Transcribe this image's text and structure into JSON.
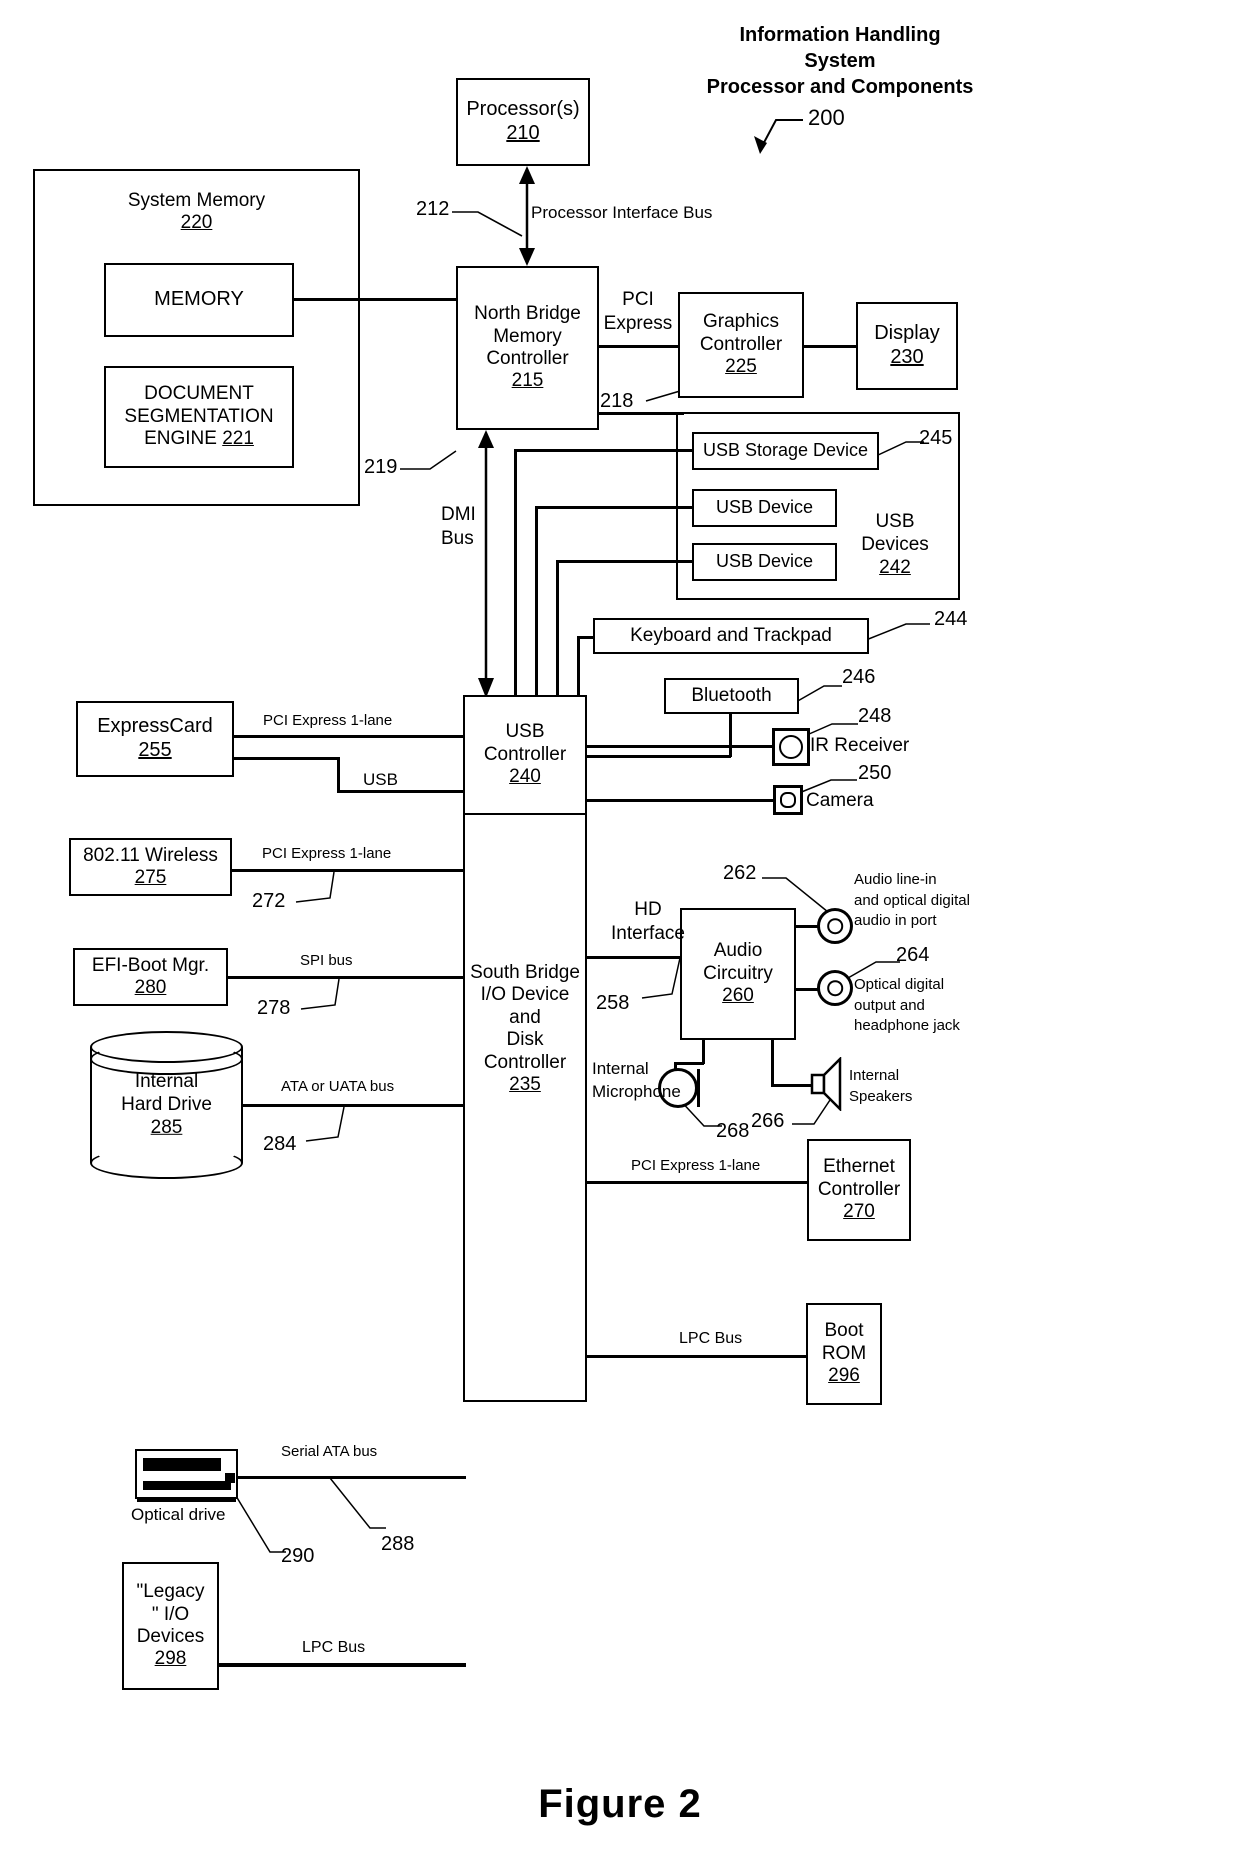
{
  "figure": {
    "caption": "Figure 2",
    "title_lines": [
      "Information Handling",
      "System",
      "Processor and Components"
    ],
    "title_ref": "200"
  },
  "blocks": {
    "processor": {
      "label": "Processor(s)",
      "ref": "210"
    },
    "system_memory": {
      "label": "System Memory",
      "ref": "220"
    },
    "memory": {
      "label": "MEMORY"
    },
    "doc_seg_engine": {
      "line1": "DOCUMENT",
      "line2": "SEGMENTATION",
      "line3": "ENGINE",
      "ref": "221"
    },
    "north_bridge": {
      "line1": "North Bridge",
      "line2": "Memory",
      "line3": "Controller",
      "ref": "215"
    },
    "graphics_controller": {
      "line1": "Graphics",
      "line2": "Controller",
      "ref": "225"
    },
    "display": {
      "label": "Display",
      "ref": "230"
    },
    "usb_storage_device": {
      "label": "USB Storage Device"
    },
    "usb_device_1": {
      "label": "USB Device"
    },
    "usb_device_2": {
      "label": "USB Device"
    },
    "usb_devices_group": {
      "line1": "USB",
      "line2": "Devices",
      "ref": "242"
    },
    "keyboard_trackpad": {
      "label": "Keyboard and Trackpad"
    },
    "bluetooth": {
      "label": "Bluetooth"
    },
    "ir_receiver": {
      "label": "IR Receiver"
    },
    "camera": {
      "label": "Camera"
    },
    "usb_controller": {
      "line1": "USB",
      "line2": "Controller",
      "ref": "240"
    },
    "south_bridge": {
      "line1": "South Bridge",
      "line2": "I/O Device",
      "line3": "and",
      "line4": "Disk",
      "line5": "Controller",
      "ref": "235"
    },
    "expresscard": {
      "label": "ExpressCard",
      "ref": "255"
    },
    "wireless": {
      "label": "802.11 Wireless",
      "ref": "275"
    },
    "efi_boot_mgr": {
      "label": "EFI-Boot Mgr.",
      "ref": "280"
    },
    "internal_hard_drive": {
      "line1": "Internal",
      "line2": "Hard Drive",
      "ref": "285"
    },
    "optical_drive": {
      "label": "Optical drive"
    },
    "legacy_io": {
      "line1": "\"Legacy",
      "line2": "\" I/O",
      "line3": "Devices",
      "ref": "298"
    },
    "audio_circuitry": {
      "line1": "Audio",
      "line2": "Circuitry",
      "ref": "260"
    },
    "audio_line_in": {
      "line1": "Audio line-in",
      "line2": "and optical digital",
      "line3": "audio in port"
    },
    "optical_digital_out": {
      "line1": "Optical digital",
      "line2": "output and",
      "line3": "headphone jack"
    },
    "internal_microphone": {
      "line1": "Internal",
      "line2": "Microphone"
    },
    "internal_speakers": {
      "line1": "Internal",
      "line2": "Speakers"
    },
    "ethernet_controller": {
      "line1": "Ethernet",
      "line2": "Controller",
      "ref": "270"
    },
    "boot_rom": {
      "line1": "Boot",
      "line2": "ROM",
      "ref": "296"
    }
  },
  "bus_labels": {
    "processor_interface_bus": "Processor Interface Bus",
    "pci_express": {
      "line1": "PCI",
      "line2": "Express"
    },
    "dmi_bus": {
      "line1": "DMI",
      "line2": "Bus"
    },
    "pci_express_1lane_expresscard": "PCI Express 1-lane",
    "usb": "USB",
    "pci_express_1lane_wireless": "PCI Express 1-lane",
    "spi_bus": "SPI bus",
    "ata_uata_bus": "ATA or UATA bus",
    "serial_ata_bus": "Serial ATA bus",
    "lpc_bus_left": "LPC Bus",
    "lpc_bus_right": "LPC Bus",
    "hd_interface": {
      "line1": "HD",
      "line2": "Interface"
    },
    "pci_express_1lane_ethernet": "PCI Express 1-lane"
  },
  "ref_numbers": {
    "r212": "212",
    "r218": "218",
    "r219": "219",
    "r244": "244",
    "r245": "245",
    "r246": "246",
    "r248": "248",
    "r250": "250",
    "r258": "258",
    "r262": "262",
    "r264": "264",
    "r266": "266",
    "r268": "268",
    "r272": "272",
    "r278": "278",
    "r284": "284",
    "r288": "288",
    "r290": "290"
  },
  "colors": {
    "line": "#000000",
    "background": "#ffffff"
  }
}
